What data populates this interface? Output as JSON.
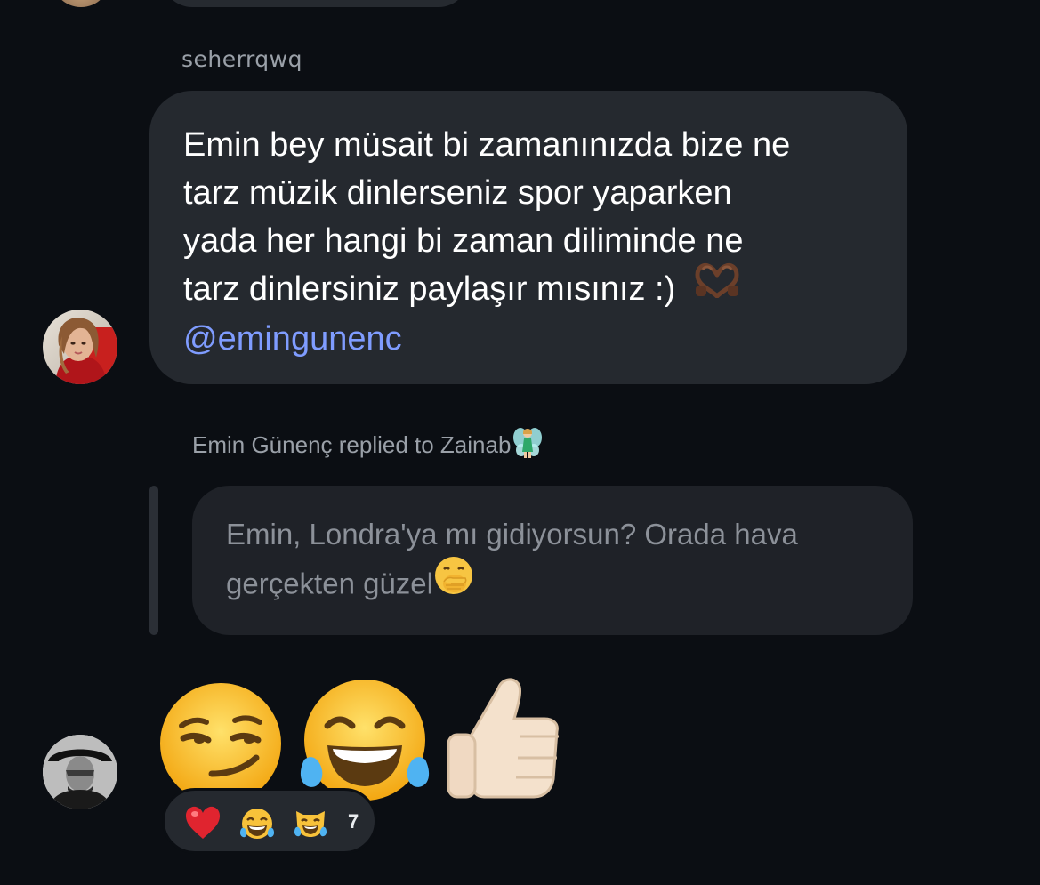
{
  "previous_message": {
    "sender": "seherrqwq",
    "text_lines": [
      "Emin bey müsait bi zamanınızda bize ne",
      "tarz müzik dinlerseniz spor yaparken",
      "yada her hangi bi zaman diliminde ne",
      "tarz dinlersiniz paylaşır mısınız :)"
    ],
    "emoji": "heart-hands-emoji",
    "mention": "@emingunenc"
  },
  "reply_context": {
    "header": "Emin Günenç replied to Zainab",
    "header_emoji": "fairy-emoji",
    "quoted_lines": [
      "Emin, Londra'ya mı gidiyorsun? Orada hava",
      "gerçekten güzel"
    ],
    "quoted_emoji": "hand-over-mouth-emoji"
  },
  "reply_message": {
    "emojis": [
      "smirking-face-emoji",
      "tears-of-joy-emoji",
      "thumbs-up-emoji"
    ],
    "reactions": {
      "icons": [
        "red-heart-emoji",
        "tears-of-joy-emoji",
        "cat-tears-of-joy-emoji"
      ],
      "count": "7"
    }
  },
  "colors": {
    "background": "#0b0e13",
    "bubble": "#25292f",
    "quoted_bubble": "#1f2228",
    "mention": "#7f9cff",
    "muted_text": "#9aa0a8"
  }
}
